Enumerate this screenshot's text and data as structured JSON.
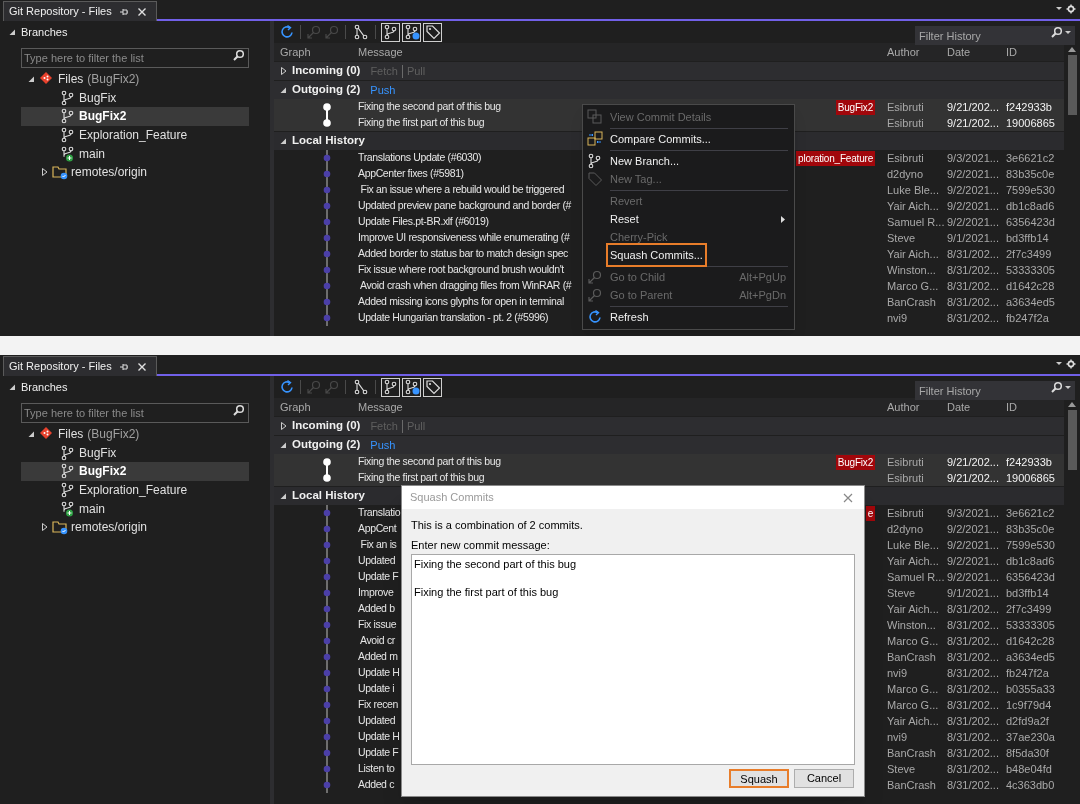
{
  "panels": [
    {
      "tab": {
        "title": "Git Repository - Files"
      },
      "branches": {
        "header": "Branches",
        "expanded": true,
        "filter_placeholder": "Type here to filter the list",
        "tree": [
          {
            "kind": "repo",
            "label": "Files",
            "note": "(BugFix2)",
            "expanded": true,
            "selected": false,
            "children": [
              {
                "kind": "branch",
                "label": "BugFix",
                "selected": false
              },
              {
                "kind": "branch",
                "label": "BugFix2",
                "selected": true
              },
              {
                "kind": "branch",
                "label": "Exploration_Feature",
                "selected": false
              },
              {
                "kind": "main",
                "label": "main",
                "selected": false
              },
              {
                "kind": "remote",
                "label": "remotes/origin",
                "expanded": false,
                "selected": false
              }
            ]
          }
        ]
      },
      "toolbar": [
        {
          "disabled": false
        },
        {
          "disabled": true
        },
        {
          "disabled": true
        },
        {
          "on": false
        },
        {
          "on": true
        },
        {
          "on": true
        },
        {
          "on": true
        }
      ],
      "filter_placeholder": "Filter History",
      "columns": [
        "Graph",
        "Message",
        "Author",
        "Date",
        "ID"
      ],
      "sections": [
        {
          "kind": "incoming",
          "label": "Incoming (0)",
          "expanded": false,
          "actions": [
            {
              "label": "Fetch",
              "disabled": true
            },
            {
              "label": "Pull",
              "disabled": true
            }
          ]
        },
        {
          "kind": "outgoing",
          "label": "Outgoing (2)",
          "expanded": true,
          "actions": [
            {
              "label": "Push",
              "disabled": false
            }
          ],
          "commits": [
            {
              "message": "Fixing the second part of this bug",
              "tag": "BugFix2",
              "author": "Esibruti",
              "date": "9/21/202...",
              "id": "f242933b"
            },
            {
              "message": "Fixing the first part of this bug",
              "author": "Esibruti",
              "date": "9/21/202...",
              "id": "19006865"
            }
          ]
        },
        {
          "kind": "local",
          "label": "Local History",
          "expanded": true,
          "commits": [
            {
              "message": "Translations Update (#6030)",
              "tag": "ploration_Feature",
              "author": "Esibruti",
              "date": "9/3/2021...",
              "id": "3e6621c2"
            },
            {
              "message": "AppCenter fixes (#5981)",
              "author": "d2dyno",
              "date": "9/2/2021...",
              "id": "83b35c0e"
            },
            {
              "message": " Fix an issue where a rebuild would be triggered",
              "author": "Luke Ble...",
              "date": "9/2/2021...",
              "id": "7599e530"
            },
            {
              "message": "Updated preview pane background and border (#",
              "author": "Yair Aich...",
              "date": "9/2/2021...",
              "id": "db1c8ad6"
            },
            {
              "message": "Update Files.pt-BR.xlf (#6019)",
              "author": "Samuel R...",
              "date": "9/2/2021...",
              "id": "6356423d"
            },
            {
              "message": "Improve UI responsiveness while enumerating (#",
              "author": "Steve",
              "date": "9/1/2021...",
              "id": "bd3ffb14"
            },
            {
              "message": "Added border to status bar to match design spec",
              "author": "Yair Aich...",
              "date": "8/31/202...",
              "id": "2f7c3499"
            },
            {
              "message": "Fix issue where root background brush wouldn't",
              "author": "Winston...",
              "date": "8/31/202...",
              "id": "53333305"
            },
            {
              "message": " Avoid crash when dragging files from WinRAR (#",
              "author": "Marco G...",
              "date": "8/31/202...",
              "id": "d1642c28"
            },
            {
              "message": "Added missing icons glyphs for open in terminal",
              "author": "BanCrash",
              "date": "8/31/202...",
              "id": "a3634ed5"
            },
            {
              "message": "Update Hungarian translation - pt. 2 (#5996)",
              "author": "nvi9",
              "date": "8/31/202...",
              "id": "fb247f2a"
            }
          ]
        }
      ],
      "context_menu": {
        "items": [
          {
            "kind": "item",
            "label": "View Commit Details",
            "disabled": true,
            "highlighted": false,
            "submenu": false
          },
          {
            "kind": "separator"
          },
          {
            "kind": "item",
            "label": "Compare Commits...",
            "disabled": false,
            "highlighted": false,
            "submenu": false
          },
          {
            "kind": "separator"
          },
          {
            "kind": "item",
            "label": "New Branch...",
            "disabled": false,
            "highlighted": false,
            "submenu": false
          },
          {
            "kind": "item",
            "label": "New Tag...",
            "disabled": true,
            "highlighted": false,
            "submenu": false
          },
          {
            "kind": "separator"
          },
          {
            "kind": "item",
            "label": "Revert",
            "disabled": true,
            "highlighted": false,
            "submenu": false
          },
          {
            "kind": "item",
            "label": "Reset",
            "disabled": false,
            "highlighted": false,
            "submenu": true
          },
          {
            "kind": "item",
            "label": "Cherry-Pick",
            "disabled": true,
            "highlighted": false,
            "submenu": false
          },
          {
            "kind": "item",
            "label": "Squash Commits...",
            "disabled": false,
            "highlighted": true,
            "submenu": false
          },
          {
            "kind": "separator"
          },
          {
            "kind": "item",
            "label": "Go to Child",
            "disabled": true,
            "highlighted": false,
            "submenu": false,
            "shortcut": "Alt+PgUp"
          },
          {
            "kind": "item",
            "label": "Go to Parent",
            "disabled": true,
            "highlighted": false,
            "submenu": false,
            "shortcut": "Alt+PgDn"
          },
          {
            "kind": "separator"
          },
          {
            "kind": "item",
            "label": "Refresh",
            "disabled": false,
            "highlighted": false,
            "submenu": false
          }
        ]
      }
    },
    {
      "tab": {
        "title": "Git Repository - Files"
      },
      "branches": {
        "header": "Branches",
        "expanded": true,
        "filter_placeholder": "Type here to filter the list",
        "tree": [
          {
            "kind": "repo",
            "label": "Files",
            "note": "(BugFix2)",
            "expanded": true,
            "selected": false,
            "children": [
              {
                "kind": "branch",
                "label": "BugFix",
                "selected": false
              },
              {
                "kind": "branch",
                "label": "BugFix2",
                "selected": true
              },
              {
                "kind": "branch",
                "label": "Exploration_Feature",
                "selected": false
              },
              {
                "kind": "main",
                "label": "main",
                "selected": false
              },
              {
                "kind": "remote",
                "label": "remotes/origin",
                "expanded": false,
                "selected": false
              }
            ]
          }
        ]
      },
      "toolbar": [
        {
          "disabled": false
        },
        {
          "disabled": true
        },
        {
          "disabled": true
        },
        {
          "on": false
        },
        {
          "on": true
        },
        {
          "on": true
        },
        {
          "on": true
        }
      ],
      "filter_placeholder": "Filter History",
      "columns": [
        "Graph",
        "Message",
        "Author",
        "Date",
        "ID"
      ],
      "sections": [
        {
          "kind": "incoming",
          "label": "Incoming (0)",
          "expanded": false,
          "actions": [
            {
              "label": "Fetch",
              "disabled": true
            },
            {
              "label": "Pull",
              "disabled": true
            }
          ]
        },
        {
          "kind": "outgoing",
          "label": "Outgoing (2)",
          "expanded": true,
          "actions": [
            {
              "label": "Push",
              "disabled": false
            }
          ],
          "commits": [
            {
              "message": "Fixing the second part of this bug",
              "tag": "BugFix2",
              "author": "Esibruti",
              "date": "9/21/202...",
              "id": "f242933b"
            },
            {
              "message": "Fixing the first part of this bug",
              "author": "Esibruti",
              "date": "9/21/202...",
              "id": "19006865"
            }
          ]
        },
        {
          "kind": "local",
          "label": "Local History",
          "expanded": true,
          "commits": [
            {
              "message": "Translatio",
              "tag": "e",
              "author": "Esibruti",
              "date": "9/3/2021...",
              "id": "3e6621c2"
            },
            {
              "message": "AppCent",
              "author": "d2dyno",
              "date": "9/2/2021...",
              "id": "83b35c0e"
            },
            {
              "message": " Fix an is",
              "author": "Luke Ble...",
              "date": "9/2/2021...",
              "id": "7599e530"
            },
            {
              "message": "Updated",
              "author": "Yair Aich...",
              "date": "9/2/2021...",
              "id": "db1c8ad6"
            },
            {
              "message": "Update F",
              "author": "Samuel R...",
              "date": "9/2/2021...",
              "id": "6356423d"
            },
            {
              "message": "Improve",
              "author": "Steve",
              "date": "9/1/2021...",
              "id": "bd3ffb14"
            },
            {
              "message": "Added b",
              "author": "Yair Aich...",
              "date": "8/31/202...",
              "id": "2f7c3499"
            },
            {
              "message": "Fix issue",
              "author": "Winston...",
              "date": "8/31/202...",
              "id": "53333305"
            },
            {
              "message": " Avoid cr",
              "author": "Marco G...",
              "date": "8/31/202...",
              "id": "d1642c28"
            },
            {
              "message": "Added m",
              "author": "BanCrash",
              "date": "8/31/202...",
              "id": "a3634ed5"
            },
            {
              "message": "Update H",
              "author": "nvi9",
              "date": "8/31/202...",
              "id": "fb247f2a"
            },
            {
              "message": "Update i",
              "author": "Marco G...",
              "date": "8/31/202...",
              "id": "b0355a33"
            },
            {
              "message": "Fix recen",
              "author": "Marco G...",
              "date": "8/31/202...",
              "id": "1c9f79d4"
            },
            {
              "message": "Updated",
              "author": "Yair Aich...",
              "date": "8/31/202...",
              "id": "d2fd9a2f"
            },
            {
              "message": "Update H",
              "author": "nvi9",
              "date": "8/31/202...",
              "id": "37ae230a"
            },
            {
              "message": "Update F",
              "author": "BanCrash",
              "date": "8/31/202...",
              "id": "8f5da30f"
            },
            {
              "message": "Listen to",
              "author": "Steve",
              "date": "8/31/202...",
              "id": "b48e04fd"
            },
            {
              "message": "Added c",
              "author": "BanCrash",
              "date": "8/31/202...",
              "id": "4c363db0"
            }
          ]
        }
      ],
      "dialog": {
        "title": "Squash Commits",
        "text": "This is a combination of 2 commits.",
        "prompt": "Enter new commit message:",
        "message": "Fixing the second part of this bug\n\nFixing the first part of this bug",
        "buttons": [
          {
            "label": "Squash",
            "highlighted": true
          },
          {
            "label": "Cancel",
            "highlighted": false
          }
        ]
      }
    }
  ]
}
